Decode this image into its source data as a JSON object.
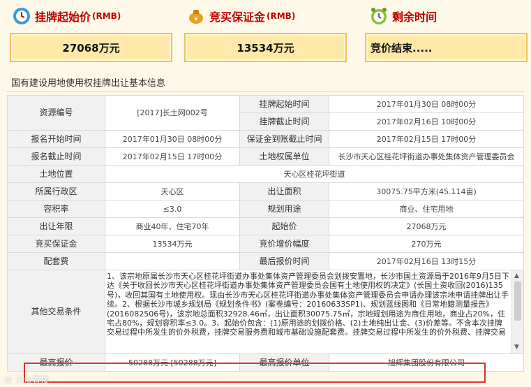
{
  "header": {
    "start_price_title": "挂牌起始价",
    "start_price_unit": "(RMB)",
    "deposit_title": "竞买保证金",
    "deposit_unit": "(RMB)",
    "remaining_title": "剩余时间",
    "start_price_value": "27068万元",
    "deposit_value": "13534万元",
    "remaining_value": "竞价结束....."
  },
  "section_title": "国有建设用地使用权挂牌出让基本信息",
  "rows": {
    "resource_no_label": "资源编号",
    "resource_no_value": "[2017]长土网002号",
    "listing_start_label": "挂牌起始时间",
    "listing_start_value": "2017年01月30日 08时00分",
    "listing_end_label": "挂牌截止时间",
    "listing_end_value": "2017年02月16日 10时00分",
    "signup_start_label": "报名开始时间",
    "signup_start_value": "2017年01月30日 08时00分",
    "deposit_deadline_label": "保证金到账截止时间",
    "deposit_deadline_value": "2017年02月15日 17时00分",
    "signup_end_label": "报名截止时间",
    "signup_end_value": "2017年02月15日 17时00分",
    "owner_label": "土地权属单位",
    "owner_value": "长沙市天心区桂花坪街道办事处集体资产管理委员会",
    "location_label": "土地位置",
    "location_value": "天心区桂花坪街道",
    "district_label": "所属行政区",
    "district_value": "天心区",
    "area_label": "出让面积",
    "area_value": "30075.75平方米(45.114亩)",
    "plot_ratio_label": "容积率",
    "plot_ratio_value": "≤3.0",
    "usage_label": "规划用途",
    "usage_value": "商业、住宅用地",
    "term_label": "出让年限",
    "term_value": "商业40年、住宅70年",
    "start_price_label": "起始价",
    "start_price_value": "27068万元",
    "bid_deposit_label": "竞买保证金",
    "bid_deposit_value": "13534万元",
    "increment_label": "竞价增价幅度",
    "increment_value": "270万元",
    "matching_fee_label": "配套费",
    "matching_fee_value": "",
    "last_quote_label": "最后报价时间",
    "last_quote_value": "2017年02月16日 13时15分",
    "other_conditions_label": "其他交易条件",
    "other_conditions_text": "1、该宗地原属长沙市天心区桂花坪街道办事处集体资产管理委员会划拨安置地，长沙市国土资源局于2016年9月5日下达《关于收回长沙市天心区桂花坪街道办事处集体资产管理委员会国有土地使用权的决定》(长国土资收回(2016)135号)，收回其国有土地使用权。现由长沙市天心区桂花坪街道办事处集体资产管理委员会申请办理该宗地申请挂牌出让手续。2、根据长沙市城乡规划局《规划条件书》(案卷编号：20160633SP1)、规划蓝线图和《日常地籍测量报告》(20160825​06号)，该宗地总面积32928.46㎡，出让面积30075.75㎡，宗地规划用途为商住用地，商业占20%，住宅占80%，规划容积率≤3.0。3、起始价包含：(1)原用途的划拨价格、(2)土地纯出让金、(3)价差等。不含本次挂牌交易过程中所发生的价外税费，挂牌交易服务费和城市基础设施配套费。挂牌交易过程中所发生的价外税费、挂牌交易",
    "highest_bid_label": "最高报价",
    "highest_bid_value": "50288万元 [50288万元]",
    "highest_bidder_label": "最高报价单位",
    "highest_bidder_value": "旭辉集团股份有限公司"
  },
  "watermark": "众 大众看楼"
}
